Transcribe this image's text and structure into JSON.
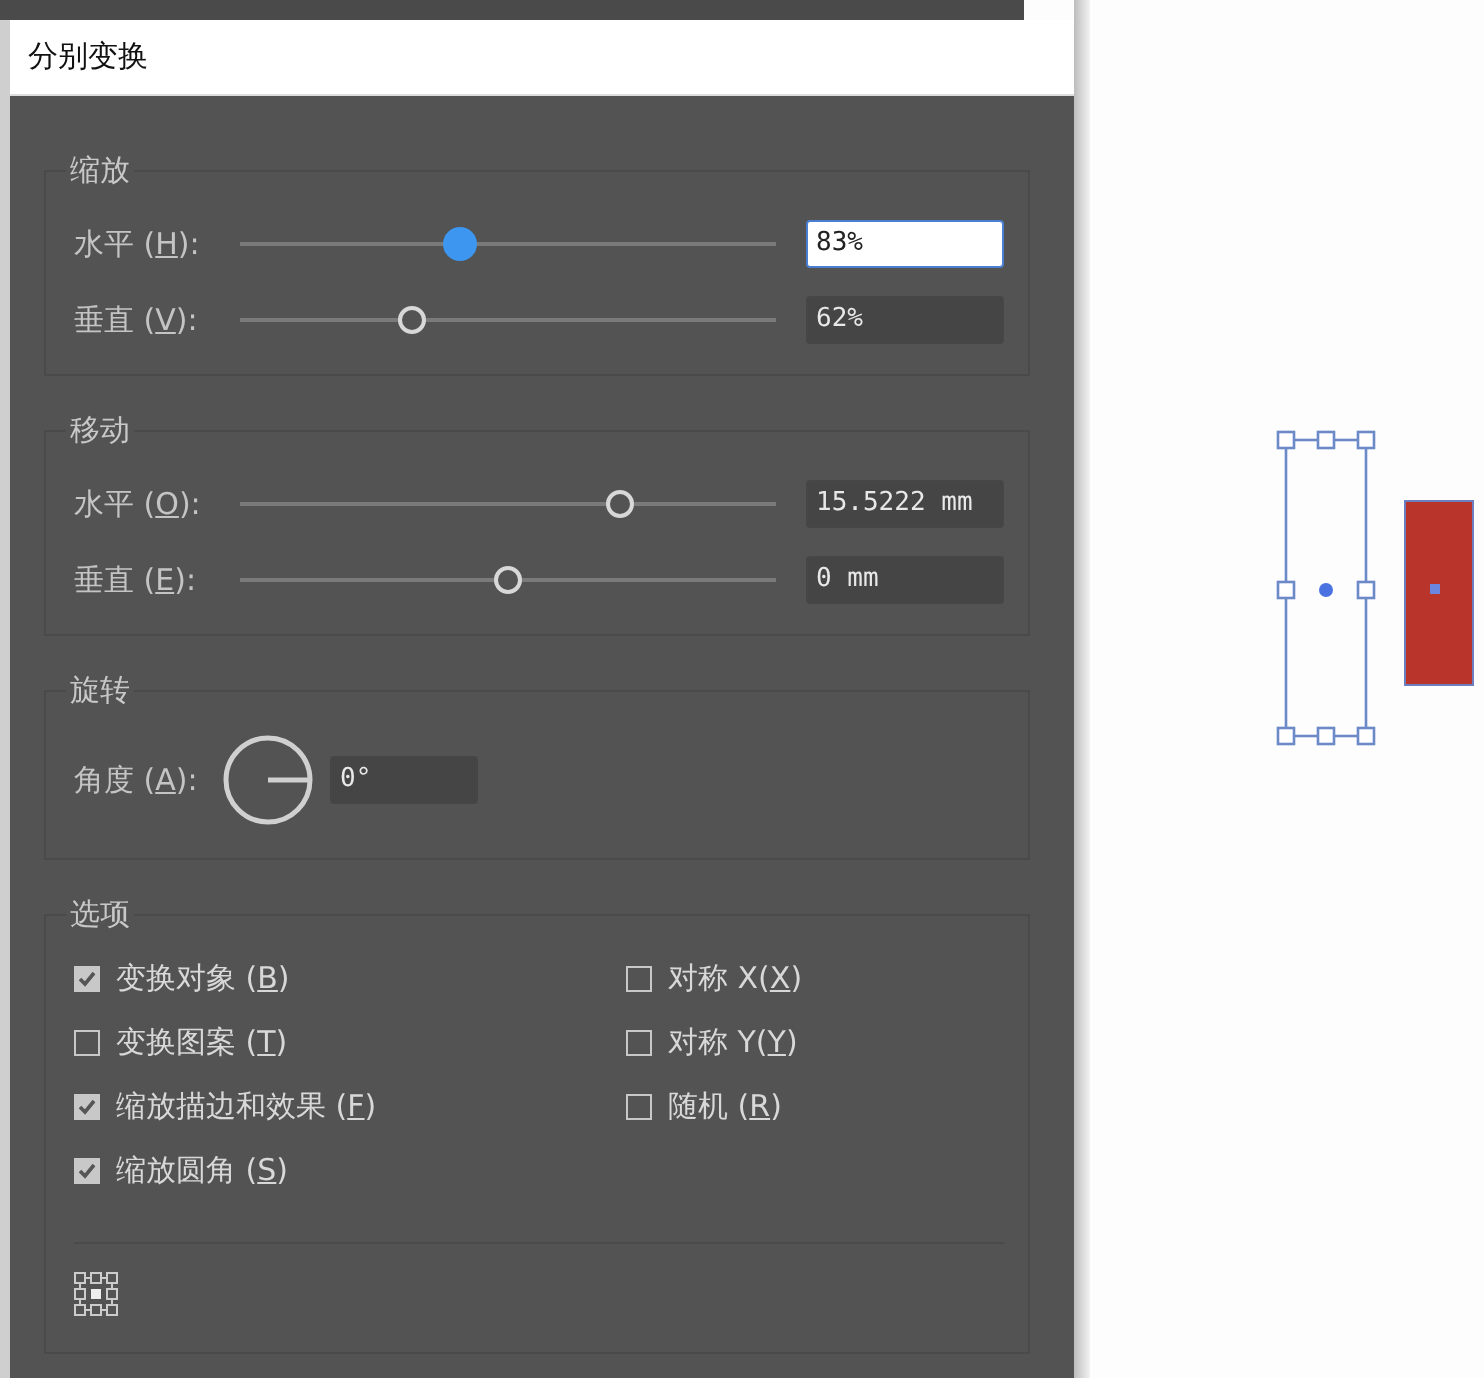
{
  "window": {
    "title": "分别变换"
  },
  "groups": [
    {
      "kind": "sliders",
      "title": "缩放",
      "rows": [
        {
          "label": "水平 (",
          "key": "H",
          "tail": "):",
          "level": 0.41,
          "value": "83%",
          "focused": true
        },
        {
          "label": "垂直 (",
          "key": "V",
          "tail": "):",
          "level": 0.32,
          "value": "62%",
          "focused": false
        }
      ]
    },
    {
      "kind": "sliders",
      "title": "移动",
      "rows": [
        {
          "label": "水平 (",
          "key": "O",
          "tail": "):",
          "level": 0.71,
          "value": "15.5222 mm",
          "focused": false
        },
        {
          "label": "垂直 (",
          "key": "E",
          "tail": "):",
          "level": 0.5,
          "value": "0 mm",
          "focused": false
        }
      ]
    },
    {
      "kind": "angle",
      "title": "旋转",
      "label": "角度 (",
      "key": "A",
      "tail": "):",
      "value": "0°"
    },
    {
      "kind": "options",
      "title": "选项",
      "options": [
        {
          "label": "变换对象 (",
          "key": "B",
          "tail": ")",
          "checked": true
        },
        {
          "label": "对称 X(",
          "key": "X",
          "tail": ")",
          "checked": false
        },
        {
          "label": "变换图案 (",
          "key": "T",
          "tail": ")",
          "checked": false
        },
        {
          "label": "对称 Y(",
          "key": "Y",
          "tail": ")",
          "checked": false
        },
        {
          "label": "缩放描边和效果 (",
          "key": "F",
          "tail": ")",
          "checked": true
        },
        {
          "label": "随机 (",
          "key": "R",
          "tail": ")",
          "checked": false
        },
        {
          "label": "缩放圆角 (",
          "key": "S",
          "tail": ")",
          "checked": true
        }
      ]
    }
  ]
}
